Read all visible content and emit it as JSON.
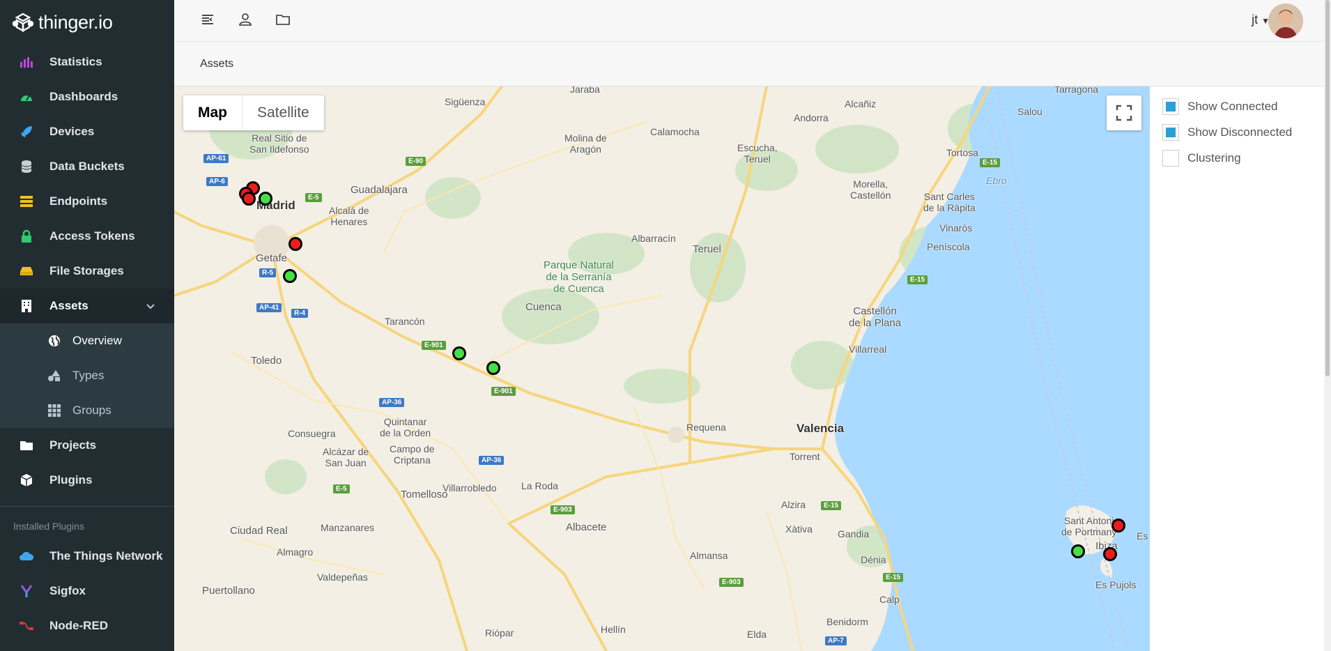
{
  "brand": "thinger.io",
  "sidebar": {
    "items": [
      {
        "label": "Statistics",
        "icon": "bar-chart-icon",
        "color": "#c445e0"
      },
      {
        "label": "Dashboards",
        "icon": "dashboard-icon",
        "color": "#2ecc71"
      },
      {
        "label": "Devices",
        "icon": "rocket-icon",
        "color": "#3ea5f0"
      },
      {
        "label": "Data Buckets",
        "icon": "database-icon",
        "color": "#c8d0d4"
      },
      {
        "label": "Endpoints",
        "icon": "server-icon",
        "color": "#f0c020"
      },
      {
        "label": "Access Tokens",
        "icon": "lock-icon",
        "color": "#2ecc71"
      },
      {
        "label": "File Storages",
        "icon": "hdd-icon",
        "color": "#f0c020"
      },
      {
        "label": "Assets",
        "icon": "building-icon",
        "color": "#ffffff"
      }
    ],
    "asset_sub": [
      {
        "label": "Overview",
        "icon": "globe-icon"
      },
      {
        "label": "Types",
        "icon": "shapes-icon"
      },
      {
        "label": "Groups",
        "icon": "grid-icon"
      }
    ],
    "items2": [
      {
        "label": "Projects",
        "icon": "folder-icon"
      },
      {
        "label": "Plugins",
        "icon": "cube-icon"
      }
    ],
    "plugins_title": "Installed Plugins",
    "plugins": [
      {
        "label": "The Things Network",
        "icon": "cloud-icon",
        "color": "#3ea5f0"
      },
      {
        "label": "Sigfox",
        "icon": "sigfox-icon",
        "color": "#8a5fd6"
      },
      {
        "label": "Node-RED",
        "icon": "nodered-icon",
        "color": "#d63a3a"
      }
    ]
  },
  "topbar": {
    "user": "jt"
  },
  "breadcrumb": "Assets",
  "map": {
    "type_map": "Map",
    "type_satellite": "Satellite",
    "labels": {
      "madrid": "Madrid",
      "valencia": "Valencia",
      "getafe": "Getafe",
      "toledo": "Toledo",
      "guadalajara": "Guadalajara",
      "cuenca": "Cuenca",
      "teruel": "Teruel",
      "albacete": "Albacete",
      "castellon": "Castellón\nde la Plana",
      "ibiza": "Ibiza",
      "siguenza": "Sigüenza",
      "calamocha": "Calamocha",
      "alcaniz": "Alcañiz",
      "tortosa": "Tortosa",
      "tarragona": "Tarragona",
      "park": "Parque Natural\nde la Serranía\nde Cuenca",
      "requena": "Requena",
      "torrent": "Torrent",
      "alzira": "Alzira",
      "xativa": "Xàtiva",
      "gandia": "Gandia",
      "denia": "Dénia",
      "calp": "Calp",
      "benidorm": "Benidorm",
      "elda": "Elda",
      "almansa": "Almansa",
      "hellin": "Hellín",
      "la_roda": "La Roda",
      "villarrobledo": "Villarrobledo",
      "tomelloso": "Tomelloso",
      "ciudad_real": "Ciudad Real",
      "puertollano": "Puertollano",
      "valdepenas": "Valdepeñas",
      "manzanares": "Manzanares",
      "almagro": "Almagro",
      "consuegra": "Consuegra",
      "alcazar": "Alcázar de\nSan Juan",
      "campo": "Campo de\nCriptana",
      "quintanar": "Quintanar\nde la Orden",
      "tarancon": "Tarancón",
      "albarracin": "Albarracín",
      "molina": "Molina de\nAragón",
      "escucha": "Escucha,\nTeruel",
      "andorra": "Andorra",
      "morella": "Morella,\nCastellón",
      "vinaros": "Vinaròs",
      "peniscola": "Peníscola",
      "villarreal": "Villarreal",
      "san_carlos": "Sant Carles\nde la Ràpita",
      "alcala": "Alcalá de\nHenares",
      "real_sitio": "Real Sitio de\nSan Ildefonso",
      "jaraba": "Jaraba",
      "salou": "Salou",
      "ebro": "Ebro",
      "riopar": "Riópar",
      "sant_antoni": "Sant Antoni\nde Portmany",
      "es_pujols": "Es Pujols",
      "es": "Es"
    },
    "shields": [
      "AP-61",
      "AP-6",
      "E-5",
      "R-5",
      "AP-41",
      "R-4",
      "E-90",
      "E-901",
      "E-901",
      "AP-36",
      "AP-36",
      "E-5",
      "E-903",
      "E-903",
      "E-15",
      "E-15",
      "E-15",
      "E-15",
      "AP-7"
    ]
  },
  "legend": {
    "connected": "Show Connected",
    "disconnected": "Show Disconnected",
    "clustering": "Clustering",
    "connected_checked": true,
    "disconnected_checked": true,
    "clustering_checked": false
  },
  "colors": {
    "connected": "#46e046",
    "disconnected": "#ee1c1c",
    "sidebar": "#222d32",
    "water": "#aadaff",
    "road": "#f7d57c"
  }
}
